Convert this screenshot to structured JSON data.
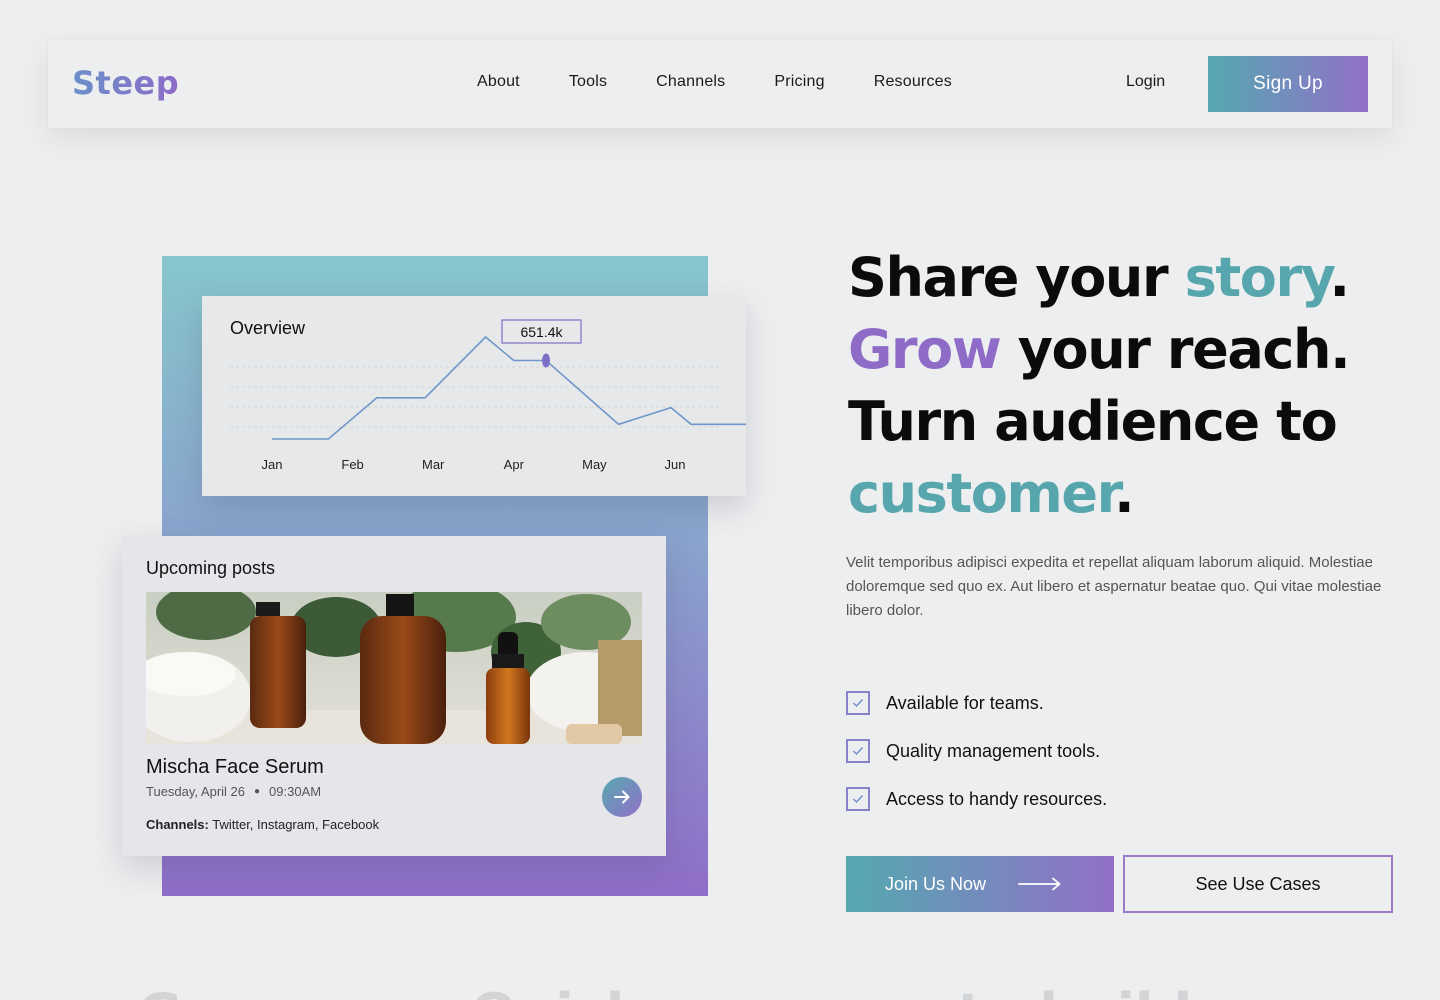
{
  "header": {
    "logo": "Steep",
    "nav": [
      {
        "label": "About"
      },
      {
        "label": "Tools"
      },
      {
        "label": "Channels"
      },
      {
        "label": "Pricing"
      },
      {
        "label": "Resources"
      }
    ],
    "login_label": "Login",
    "signup_label": "Sign Up"
  },
  "overview": {
    "title": "Overview",
    "tooltip": "651.4k"
  },
  "chart_data": {
    "type": "line",
    "title": "Overview",
    "categories": [
      "Jan",
      "Feb",
      "Mar",
      "Apr",
      "May",
      "Jun"
    ],
    "x": [
      0.0,
      0.7,
      1.3,
      1.9,
      2.65,
      3.0,
      3.4,
      4.3,
      4.95,
      5.2,
      6.0
    ],
    "y": [
      0,
      0,
      420,
      420,
      1040,
      800,
      800,
      150,
      320,
      150,
      150
    ],
    "highlight": {
      "x": 3.4,
      "y": 800,
      "label": "651.4k"
    },
    "ylim": [
      0,
      1050
    ],
    "grid": true,
    "line_color": "#6f97c9"
  },
  "posts": {
    "title": "Upcoming posts",
    "item": {
      "name": "Mischa Face Serum",
      "date": "Tuesday, April 26",
      "time": "09:30AM",
      "channels_label": "Channels:",
      "channels": "Twitter, Instagram, Facebook"
    }
  },
  "hero": {
    "line1": {
      "a": "Share your ",
      "b": "story",
      "c": "."
    },
    "line2": {
      "a": "Grow",
      "b": " your reach."
    },
    "line3": "Turn audience to",
    "line4": {
      "a": "customer",
      "b": "."
    },
    "description": "Velit temporibus adipisci expedita et repellat aliquam laborum aliquid. Molestiae doloremque sed quo ex. Aut libero et aspernatur beatae quo. Qui vitae molestiae libero dolor.",
    "features": [
      {
        "label": "Available for teams."
      },
      {
        "label": "Quality management tools."
      },
      {
        "label": "Access to handy resources."
      }
    ],
    "join_label": "Join Us Now",
    "usecase_label": "See Use Cases"
  },
  "next_section_text": "Grow your Quick response to build your audience",
  "colors": {
    "teal": "#57a6ad",
    "purple": "#8e6bc7",
    "background": "#eceeef"
  }
}
